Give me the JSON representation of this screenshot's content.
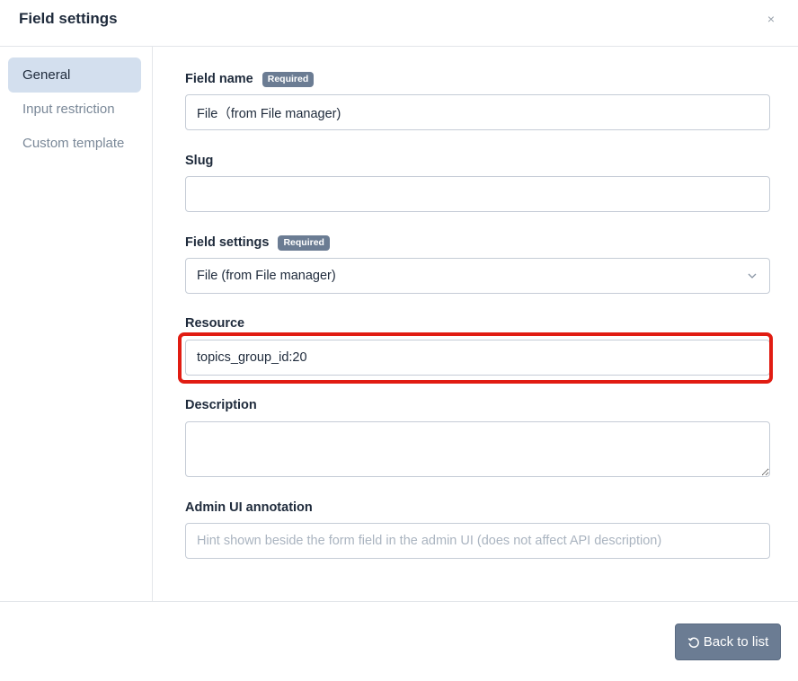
{
  "modal": {
    "title": "Field settings",
    "close_glyph": "×"
  },
  "sidebar": {
    "items": [
      {
        "label": "General",
        "active": true
      },
      {
        "label": "Input restriction",
        "active": false
      },
      {
        "label": "Custom template",
        "active": false
      }
    ]
  },
  "form": {
    "field_name": {
      "label": "Field name",
      "badge": "Required",
      "value": "File（from File manager)"
    },
    "slug": {
      "label": "Slug",
      "value": ""
    },
    "field_settings": {
      "label": "Field settings",
      "badge": "Required",
      "selected": "File (from File manager)"
    },
    "resource": {
      "label": "Resource",
      "value": "topics_group_id:20"
    },
    "description": {
      "label": "Description",
      "value": ""
    },
    "admin_annotation": {
      "label": "Admin UI annotation",
      "placeholder": "Hint shown beside the form field in the admin UI (does not affect API description)"
    }
  },
  "footer": {
    "back_label": "Back to list"
  },
  "colors": {
    "accent": "#6b7c93",
    "highlight": "#e11c12",
    "active_nav_bg": "#d3dfee"
  },
  "icons": {
    "close": "close-icon",
    "select_caret": "chevron-down-icon",
    "back": "undo-icon"
  }
}
